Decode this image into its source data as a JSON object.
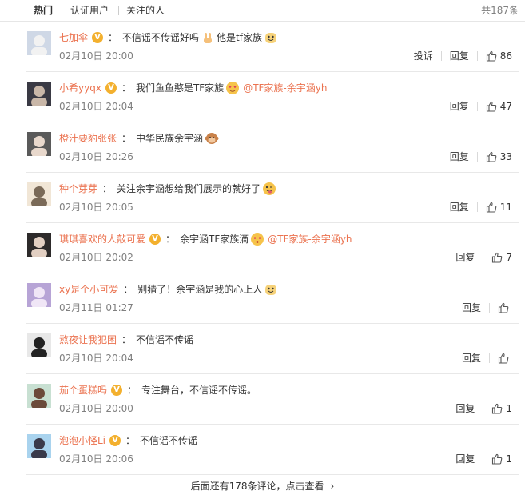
{
  "tabs": [
    {
      "label": "热门"
    },
    {
      "label": "认证用户"
    },
    {
      "label": "关注的人"
    }
  ],
  "total": "共187条",
  "comments": [
    {
      "user": "七加伞",
      "verified": true,
      "text": "不信谣不传谣好吗",
      "emoji1": "victory-hand-emoji",
      "text2": "他是tf家族",
      "emoji2": "smile-face-emoji",
      "mention": "",
      "time": "02月10日 20:00",
      "report": "投诉",
      "reply": "回复",
      "likes": "86"
    },
    {
      "user": "小希yyqx",
      "verified": true,
      "text": "我们鱼鱼憨是TF家族",
      "emoji1": "heart-eyes-emoji",
      "text2": "",
      "emoji2": "",
      "mention": "@TF家族-余宇涵yh",
      "time": "02月10日 20:04",
      "report": "",
      "reply": "回复",
      "likes": "47"
    },
    {
      "user": "橙汁要豹张张",
      "verified": false,
      "text": "中华民族余宇涵",
      "emoji1": "monkey-emoji",
      "text2": "",
      "emoji2": "",
      "mention": "",
      "time": "02月10日 20:26",
      "report": "",
      "reply": "回复",
      "likes": "33"
    },
    {
      "user": "种个芽芽",
      "verified": false,
      "text": "关注余宇涵想给我们展示的就好了",
      "emoji1": "tongue-face-emoji",
      "text2": "",
      "emoji2": "",
      "mention": "",
      "time": "02月10日 20:05",
      "report": "",
      "reply": "回复",
      "likes": "11"
    },
    {
      "user": "琪琪喜欢的人敲可爱",
      "verified": true,
      "text": "余宇涵TF家族滴",
      "emoji1": "kiss-face-emoji",
      "text2": "",
      "emoji2": "",
      "mention": "@TF家族-余宇涵yh",
      "time": "02月10日 20:02",
      "report": "",
      "reply": "回复",
      "likes": "7"
    },
    {
      "user": "xy是个小可爱",
      "verified": false,
      "text": "别猜了！余宇涵是我的心上人",
      "emoji1": "smile-face-emoji",
      "text2": "",
      "emoji2": "",
      "mention": "",
      "time": "02月11日 01:27",
      "report": "",
      "reply": "回复",
      "likes": ""
    },
    {
      "user": "熬夜让我犯困",
      "verified": false,
      "text": "不信谣不传谣",
      "emoji1": "",
      "text2": "",
      "emoji2": "",
      "mention": "",
      "time": "02月10日 20:04",
      "report": "",
      "reply": "回复",
      "likes": ""
    },
    {
      "user": "茄个蛋糕吗",
      "verified": true,
      "text": "专注舞台，不信谣不传谣。",
      "emoji1": "",
      "text2": "",
      "emoji2": "",
      "mention": "",
      "time": "02月10日 20:00",
      "report": "",
      "reply": "回复",
      "likes": "1"
    },
    {
      "user": "泡泡小怪Li",
      "verified": true,
      "text": "不信谣不传谣",
      "emoji1": "",
      "text2": "",
      "emoji2": "",
      "mention": "",
      "time": "02月10日 20:06",
      "report": "",
      "reply": "回复",
      "likes": "1"
    }
  ],
  "footer": {
    "more": "后面还有178条评论，点击查看",
    "chev": "›"
  },
  "colors": {
    "name": "#eb7350",
    "badge": "#f3b02e"
  },
  "icons": {
    "verified": "verified-badge-icon",
    "like": "thumbs-up-icon"
  }
}
